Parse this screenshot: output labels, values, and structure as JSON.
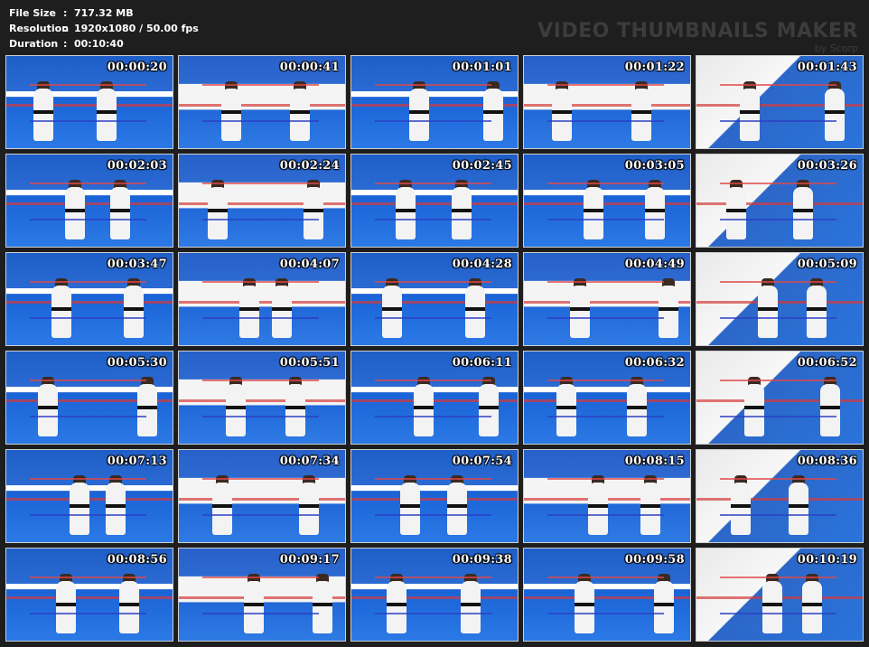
{
  "info": {
    "file_size_label": "File Size",
    "file_size_value": "717.32 MB",
    "resolution_label": "Resolution",
    "resolution_value": "1920x1080 / 50.00 fps",
    "duration_label": "Duration",
    "duration_value": "00:10:40",
    "separator": ":"
  },
  "brand": {
    "title": "VIDEO THUMBNAILS MAKER",
    "by": "by Scorp"
  },
  "thumbnails": [
    "00:00:20",
    "00:00:41",
    "00:01:01",
    "00:01:22",
    "00:01:43",
    "00:02:03",
    "00:02:24",
    "00:02:45",
    "00:03:05",
    "00:03:26",
    "00:03:47",
    "00:04:07",
    "00:04:28",
    "00:04:49",
    "00:05:09",
    "00:05:30",
    "00:05:51",
    "00:06:11",
    "00:06:32",
    "00:06:52",
    "00:07:13",
    "00:07:34",
    "00:07:54",
    "00:08:15",
    "00:08:36",
    "00:08:56",
    "00:09:17",
    "00:09:38",
    "00:09:58",
    "00:10:19"
  ],
  "colors": {
    "background": "#1e1e1e",
    "mat_blue": "#2b79e6",
    "rope_red": "#d63a3a"
  }
}
